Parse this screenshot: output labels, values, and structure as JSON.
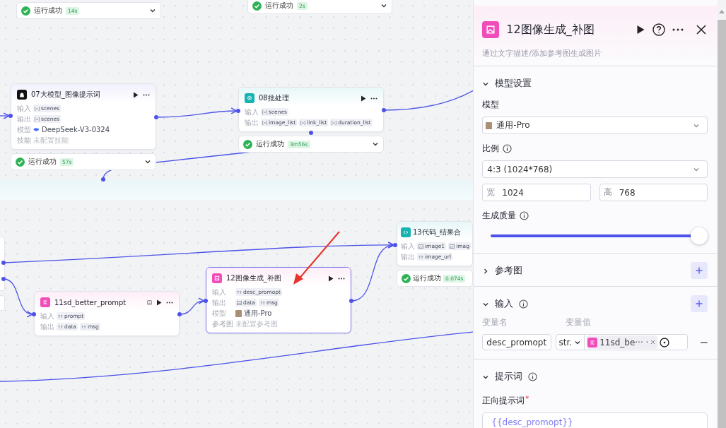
{
  "canvas": {
    "nodes": [
      {
        "kind": "status",
        "status": {
          "text": "运行成功",
          "time": "14s"
        }
      },
      {
        "kind": "status",
        "status": {
          "text": "运行成功",
          "time": "2s"
        }
      },
      {
        "kind": "llm",
        "title": "07大模型_图像提示词",
        "selected": false,
        "flag_icon": false,
        "rows": [
          {
            "label": "输入",
            "kind": "tags",
            "tags": [
              {
                "kind": "arr",
                "text": "scenes"
              }
            ]
          },
          {
            "label": "输出",
            "kind": "tags",
            "tags": [
              {
                "kind": "arr",
                "text": "scenes"
              }
            ]
          },
          {
            "label": "模型",
            "kind": "model",
            "model": {
              "kind": "deepseek",
              "text": "DeepSeek-V3-0324"
            }
          },
          {
            "label": "技能",
            "kind": "empty",
            "text": "未配置技能"
          }
        ],
        "status": {
          "text": "运行成功",
          "time": "57s"
        }
      },
      {
        "kind": "batch",
        "title": "08批处理",
        "selected": false,
        "flag_icon": false,
        "rows": [
          {
            "label": "输入",
            "kind": "tags",
            "tags": [
              {
                "kind": "arr",
                "text": "scenes"
              }
            ]
          },
          {
            "label": "输出",
            "kind": "tags",
            "tags": [
              {
                "kind": "arr",
                "text": "image_list"
              },
              {
                "kind": "arr",
                "text": "link_list"
              },
              {
                "kind": "arr",
                "text": "duration_list"
              }
            ]
          }
        ],
        "status": {
          "text": "运行成功",
          "time": "3m56s"
        }
      },
      {
        "kind": "code",
        "title": "13代码_结果合",
        "selected": false,
        "flag_icon": false,
        "rows": [
          {
            "label": "输入",
            "kind": "tags",
            "tags": [
              {
                "kind": "img",
                "text": "image1"
              },
              {
                "kind": "img",
                "text": "imag"
              }
            ]
          },
          {
            "label": "输出",
            "kind": "tags",
            "tags": [
              {
                "kind": "str",
                "text": "image_url"
              }
            ]
          }
        ],
        "status": {
          "text": "运行成功",
          "time": "0.074s"
        }
      },
      {
        "kind": "prompt",
        "title": "11sd_better_prompt",
        "selected": false,
        "flag_icon": true,
        "rows": [
          {
            "label": "输入",
            "kind": "tags",
            "tags": [
              {
                "kind": "str",
                "text": "prompt"
              }
            ]
          },
          {
            "label": "输出",
            "kind": "tags",
            "tags": [
              {
                "kind": "str",
                "text": "data"
              },
              {
                "kind": "str",
                "text": "msg"
              }
            ]
          }
        ]
      },
      {
        "kind": "image",
        "title": "12图像生成_补图",
        "selected": true,
        "flag_icon": false,
        "rows": [
          {
            "label": "输入",
            "kind": "tags",
            "tags": [
              {
                "kind": "str",
                "text": "desc_promopt"
              }
            ]
          },
          {
            "label": "输出",
            "kind": "tags",
            "tags": [
              {
                "kind": "img",
                "text": "data"
              },
              {
                "kind": "str",
                "text": "msg"
              }
            ]
          },
          {
            "label": "模型",
            "kind": "model",
            "model": {
              "kind": "photo",
              "text": "通用-Pro"
            }
          },
          {
            "label": "参考图",
            "kind": "empty",
            "text": "未配置参考图"
          }
        ]
      }
    ]
  },
  "panel": {
    "title": "12图像生成_补图",
    "description": "通过文字描述/添加参考图生成图片",
    "model_settings": {
      "heading": "模型设置",
      "expanded": true,
      "model": {
        "label": "模型",
        "value": "通用-Pro"
      },
      "ratio": {
        "label": "比例",
        "value": "4:3 (1024*768)"
      },
      "width": {
        "label": "宽",
        "value": "1024"
      },
      "height": {
        "label": "高",
        "value": "768"
      },
      "quality": {
        "label": "生成质量",
        "level": 1
      }
    },
    "reference": {
      "heading": "参考图",
      "expanded": false
    },
    "inputs": {
      "heading": "输入",
      "expanded": true,
      "name_header": "变量名",
      "value_header": "变量值",
      "rows": [
        {
          "name": "desc_promopt",
          "type": "str.",
          "ref": "11sd_be··· ·"
        }
      ]
    },
    "prompt": {
      "heading": "提示词",
      "expanded": true,
      "positive_label": "正向提示词",
      "required_mark": "*",
      "positive_value": "{{desc_promopt}}"
    }
  }
}
